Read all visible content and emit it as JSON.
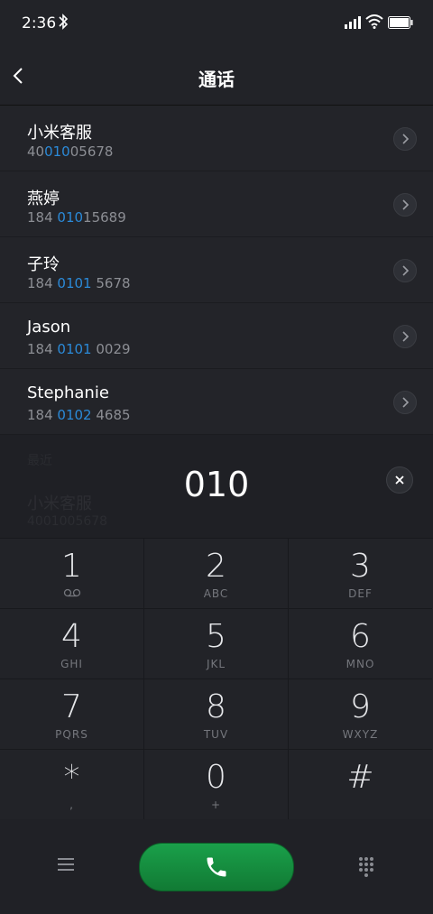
{
  "status": {
    "time": "2:36"
  },
  "header": {
    "title": "通话"
  },
  "contacts": [
    {
      "name": "小米客服",
      "number_pre": "40",
      "number_hl": "010",
      "number_post": "05678"
    },
    {
      "name": "燕婷",
      "number_pre": "184 ",
      "number_hl": "010",
      "number_post": "15689"
    },
    {
      "name": "子玲",
      "number_pre": "184 ",
      "number_hl": "0101",
      "number_post": " 5678"
    },
    {
      "name": "Jason",
      "number_pre": "184 ",
      "number_hl": "0101",
      "number_post": " 0029"
    },
    {
      "name": "Stephanie",
      "number_pre": "184 ",
      "number_hl": "0102",
      "number_post": " 4685"
    }
  ],
  "ghost": {
    "label": "最近",
    "name": "小米客服",
    "number": "4001005678"
  },
  "dialer": {
    "value": "010"
  },
  "keys": [
    {
      "digit": "1",
      "letters": ""
    },
    {
      "digit": "2",
      "letters": "ABC"
    },
    {
      "digit": "3",
      "letters": "DEF"
    },
    {
      "digit": "4",
      "letters": "GHI"
    },
    {
      "digit": "5",
      "letters": "JKL"
    },
    {
      "digit": "6",
      "letters": "MNO"
    },
    {
      "digit": "7",
      "letters": "PQRS"
    },
    {
      "digit": "8",
      "letters": "TUV"
    },
    {
      "digit": "9",
      "letters": "WXYZ"
    },
    {
      "digit": "*",
      "letters": ","
    },
    {
      "digit": "0",
      "letters": "+"
    },
    {
      "digit": "#",
      "letters": ""
    }
  ],
  "colors": {
    "highlight": "#2b8ad8",
    "call": "#1aa04a",
    "background": "#222328"
  }
}
